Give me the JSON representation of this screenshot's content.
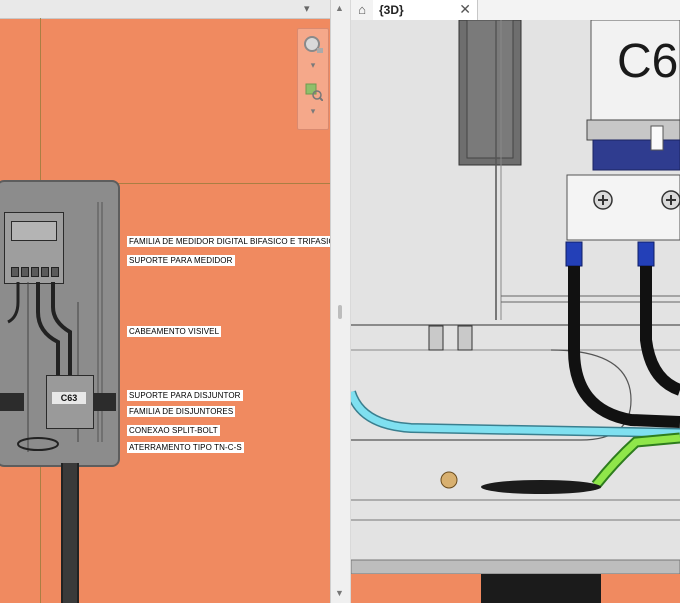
{
  "left_view": {
    "breaker_label": "C63",
    "annotations": [
      "FAMILIA DE MEDIDOR DIGITAL BIFASICO E TRIFASICO",
      "SUPORTE PARA MEDIDOR",
      "CABEAMENTO VISIVEL",
      "SUPORTE PARA DISJUNTOR",
      "FAMILIA DE DISJUNTORES",
      "CONEXAO SPLIT-BOLT",
      "ATERRAMENTO TIPO TN-C-S"
    ],
    "background_color": "#f08a60"
  },
  "right_view": {
    "tab_label": "{3D}",
    "close_glyph": "✕",
    "breaker_text": "C6",
    "background_color": "#dcdcdc"
  },
  "icons": {
    "home": "home-icon",
    "close": "close-icon",
    "dropdown": "chevron-down-icon",
    "nav_2d": "view-2d-icon",
    "zoom": "zoom-icon"
  }
}
